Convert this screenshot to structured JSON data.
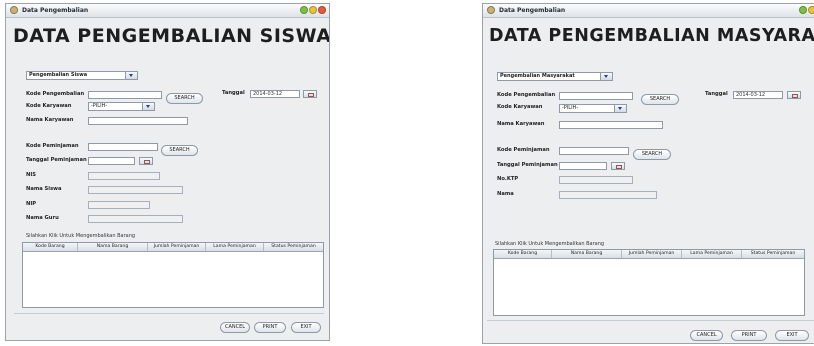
{
  "colors": {
    "window_bg": "#eceef0",
    "close": "#e25b3a",
    "minimize": "#e8c23a",
    "maximize": "#7cc242",
    "combo_arrow": "#1d3f9c"
  },
  "window1": {
    "title": "Data Pengembalian",
    "heading": "DATA PENGEMBALIAN SISWA",
    "type_select": "Pengembalian Siswa",
    "kode_pengembalian_label": "Kode Pengembalian",
    "search_label": "SEARCH",
    "tanggal_label": "Tanggal",
    "tanggal_value": "2014-03-12",
    "kode_karyawan_label": "Kode Karyawan",
    "kode_karyawan_select": "-PILIH-",
    "nama_karyawan_label": "Nama Karyawan",
    "kode_peminjaman_label": "Kode Peminjaman",
    "tanggal_peminjaman_label": "Tanggal Peminjaman",
    "nis_label": "NIS",
    "nama_siswa_label": "Nama Siswa",
    "nip_label": "NIP",
    "nama_guru_label": "Nama Guru",
    "instruction": "Silahkan Klik Untuk Mengembalikan Barang",
    "columns": [
      "Kode Barang",
      "Nama Barang",
      "Jumlah Peminjaman",
      "Lama Peminjaman",
      "Status Peminjaman"
    ],
    "cancel_label": "CANCEL",
    "print_label": "PRINT",
    "exit_label": "EXIT"
  },
  "window2": {
    "title": "Data Pengembalian",
    "heading": "DATA PENGEMBALIAN MASYARAKAT",
    "type_select": "Pengembalian Masyarakat",
    "kode_pengembalian_label": "Kode Pengembalian",
    "search_label": "SEARCH",
    "tanggal_label": "Tanggal",
    "tanggal_value": "2014-03-12",
    "kode_karyawan_label": "Kode Karyawan",
    "kode_karyawan_select": "-PILIH-",
    "nama_karyawan_label": "Nama Karyawan",
    "kode_peminjaman_label": "Kode Peminjaman",
    "tanggal_peminjaman_label": "Tanggal Peminjaman",
    "no_ktp_label": "No.KTP",
    "nama_label": "Nama",
    "instruction": "Silahkan Klik Untuk Mengembalikan Barang",
    "columns": [
      "Kode Barang",
      "Nama Barang",
      "Jumlah Peminjaman",
      "Lama Peminjaman",
      "Status Peminjaman"
    ],
    "cancel_label": "CANCEL",
    "print_label": "PRINT",
    "exit_label": "EXIT"
  }
}
